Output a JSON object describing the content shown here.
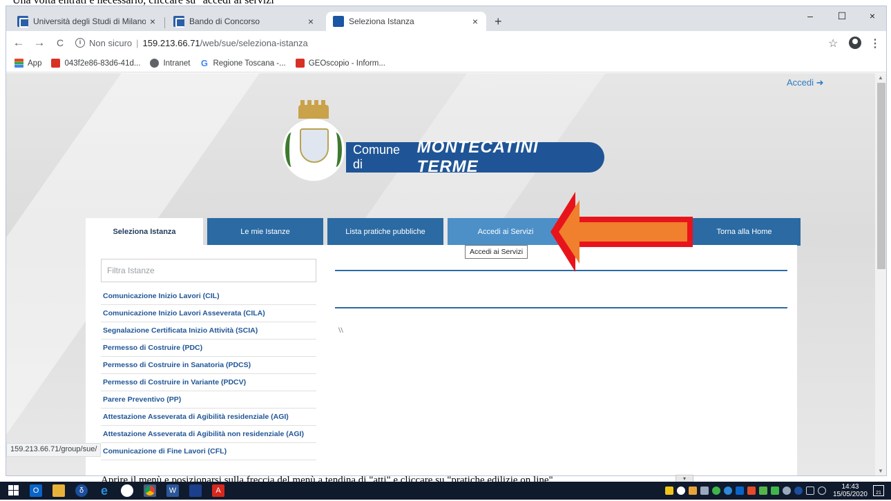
{
  "doc": {
    "top_text": "Una volta entrati è necessario, cliccare su \"accedi ai servizi\"",
    "bottom_text": "Aprire il menù e posizionarsi sulla freccia del menù a tendina di \"atti\" e cliccare su \"pratiche edilizie on line\""
  },
  "browser": {
    "tabs": [
      {
        "title": "Università degli Studi di Milano: c",
        "close": "×"
      },
      {
        "title": "Bando di Concorso",
        "close": "×"
      },
      {
        "title": "Seleziona Istanza",
        "close": "×"
      }
    ],
    "new_tab": "+",
    "window_controls": {
      "minimize": "–",
      "maximize": "☐",
      "close": "×"
    },
    "nav": {
      "back": "←",
      "forward": "→",
      "reload": "C"
    },
    "address": {
      "security_label": "Non sicuro",
      "separator": "|",
      "host": "159.213.66.71",
      "path": "/web/sue/seleziona-istanza"
    },
    "star": "☆",
    "menu": "⋮",
    "bookmarks": [
      {
        "label": "App",
        "icon": "apps-icon"
      },
      {
        "label": "043f2e86-83d6-41d...",
        "icon": "red-favicon-icon"
      },
      {
        "label": "Intranet",
        "icon": "globe-icon"
      },
      {
        "label": "Regione Toscana -...",
        "icon": "google-icon"
      },
      {
        "label": "GEOscopio - Inform...",
        "icon": "red-favicon-icon"
      }
    ],
    "status_url": "159.213.66.71/group/sue/"
  },
  "site": {
    "login_link": "Accedi ➜",
    "banner_pre": "Comune di",
    "banner_main": "MONTECATINI TERME",
    "nav_tabs": [
      {
        "label": "Seleziona Istanza",
        "state": "active"
      },
      {
        "label": "Le mie Istanze",
        "state": "normal"
      },
      {
        "label": "Lista pratiche pubbliche",
        "state": "normal"
      },
      {
        "label": "Accedi ai Servizi",
        "state": "hover"
      },
      {
        "label": "",
        "state": "normal"
      },
      {
        "label": "Torna alla Home",
        "state": "normal"
      }
    ],
    "tooltip": "Accedi ai Servizi",
    "filter_placeholder": "Filtra Istanze",
    "istanze": [
      "Comunicazione Inizio Lavori (CIL)",
      "Comunicazione Inizio Lavori Asseverata (CILA)",
      "Segnalazione Certificata Inizio Attività (SCIA)",
      "Permesso di Costruire (PDC)",
      "Permesso di Costruire in Sanatoria (PDCS)",
      "Permesso di Costruire in Variante (PDCV)",
      "Parere Preventivo (PP)",
      "Attestazione Asseverata di Agibilità residenziale (AGI)",
      "Attestazione Asseverata di Agibilità non residenziale (AGI)",
      "Comunicazione di Fine Lavori (CFL)"
    ],
    "content_text": "\\\\"
  },
  "taskbar": {
    "time": "14:43",
    "date": "15/05/2020",
    "notifications": "21"
  },
  "colors": {
    "brand_blue": "#1f5596",
    "tab_blue": "#2b6aa3",
    "hover_blue": "#4d90c8",
    "arrow_red": "#e8141b",
    "arrow_orange": "#f07f2e"
  }
}
